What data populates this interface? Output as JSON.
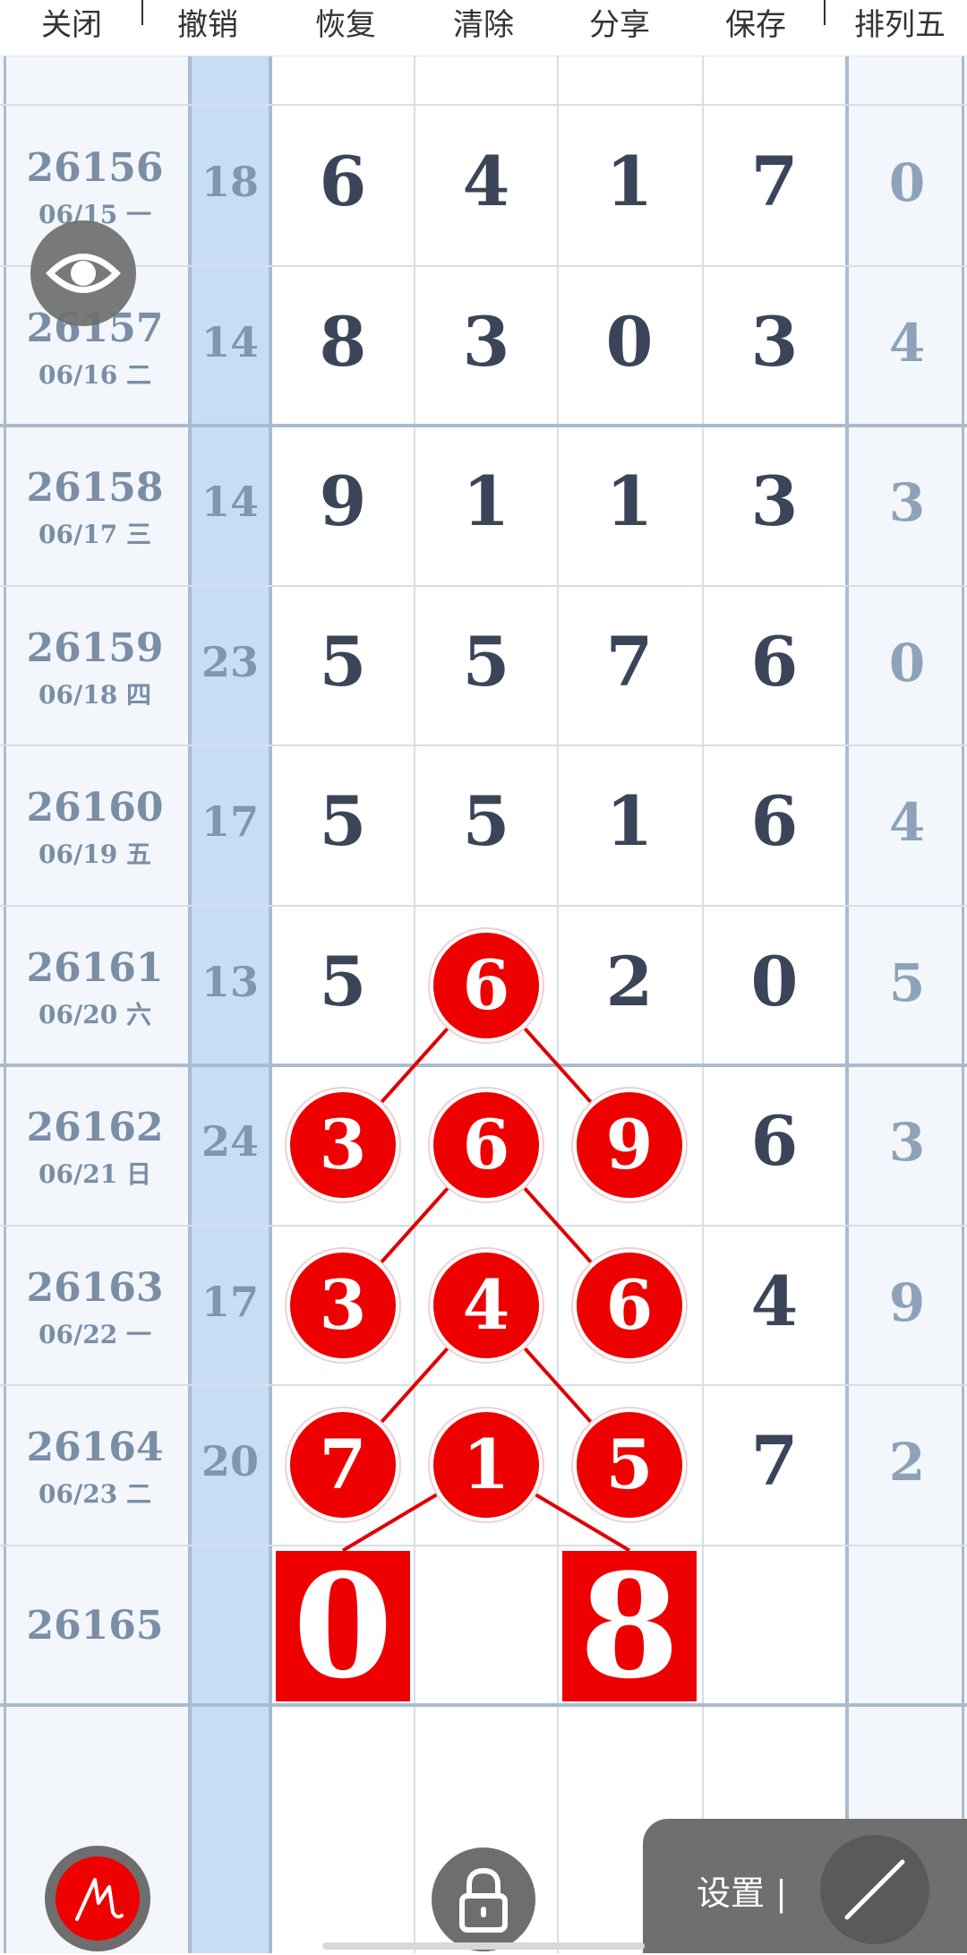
{
  "toolbar": {
    "close": "关闭",
    "undo": "撤销",
    "redo": "恢复",
    "clear": "清除",
    "share": "分享",
    "save": "保存",
    "lottery": "排列五"
  },
  "rows": [
    {
      "period": "26156",
      "date": "06/15 一",
      "sum": "18",
      "digits": [
        "6",
        "4",
        "1",
        "7"
      ],
      "p5": "0"
    },
    {
      "period": "26157",
      "date": "06/16 二",
      "sum": "14",
      "digits": [
        "8",
        "3",
        "0",
        "3"
      ],
      "p5": "4"
    },
    {
      "period": "26158",
      "date": "06/17 三",
      "sum": "14",
      "digits": [
        "9",
        "1",
        "1",
        "3"
      ],
      "p5": "3"
    },
    {
      "period": "26159",
      "date": "06/18 四",
      "sum": "23",
      "digits": [
        "5",
        "5",
        "7",
        "6"
      ],
      "p5": "0"
    },
    {
      "period": "26160",
      "date": "06/19 五",
      "sum": "17",
      "digits": [
        "5",
        "5",
        "1",
        "6"
      ],
      "p5": "4"
    },
    {
      "period": "26161",
      "date": "06/20 六",
      "sum": "13",
      "digits": [
        "5",
        "6",
        "2",
        "0"
      ],
      "p5": "5"
    },
    {
      "period": "26162",
      "date": "06/21 日",
      "sum": "24",
      "digits": [
        "3",
        "6",
        "9",
        "6"
      ],
      "p5": "3"
    },
    {
      "period": "26163",
      "date": "06/22 一",
      "sum": "17",
      "digits": [
        "3",
        "4",
        "6",
        "4"
      ],
      "p5": "9"
    },
    {
      "period": "26164",
      "date": "06/23 二",
      "sum": "20",
      "digits": [
        "7",
        "1",
        "5",
        "7"
      ],
      "p5": "2"
    },
    {
      "period": "26165",
      "date": "",
      "sum": "",
      "digits": [
        "",
        "",
        "",
        ""
      ],
      "p5": ""
    }
  ],
  "prediction": {
    "left": "0",
    "right": "8"
  },
  "panel": {
    "settings_label": "设置 |"
  },
  "colors": {
    "highlight": "#ee0000",
    "sum_column": "#c9dcf5",
    "side_column": "#f3f6fb",
    "text_dark": "#3b4458",
    "text_muted": "#7a8ea6"
  },
  "icons": [
    "eye-icon",
    "pen-icon",
    "lock-icon",
    "slash-icon"
  ]
}
